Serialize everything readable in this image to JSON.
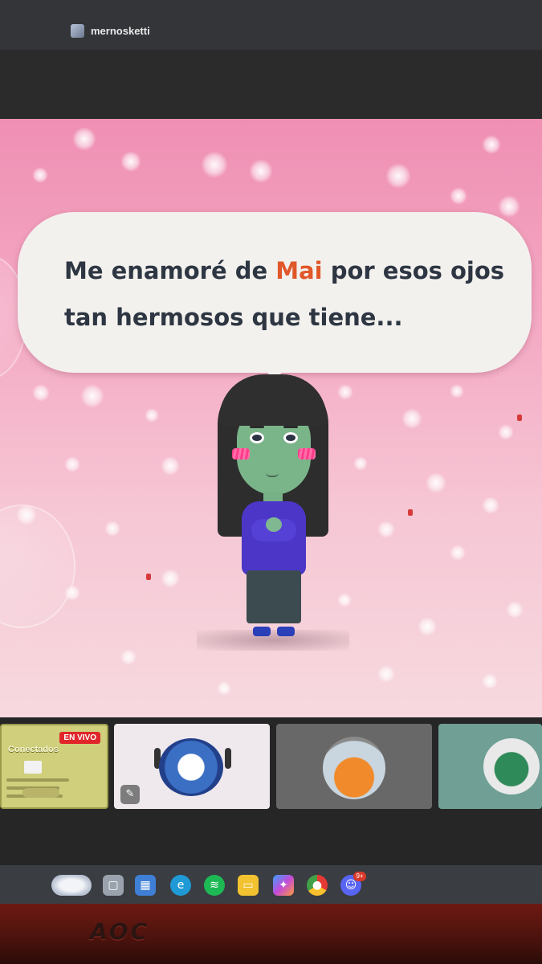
{
  "stream": {
    "username": "mernosketti"
  },
  "game": {
    "dialogue_before": "Me enamoré de ",
    "dialogue_name": "Mai",
    "dialogue_after": " por esos ojos tan hermosos que tiene...",
    "colors": {
      "background_top": "#ef8fb3",
      "background_bottom": "#f7d9df",
      "name_highlight": "#e0572a",
      "dialogue_text": "#2d3642",
      "mii_shirt": "#4b36c8",
      "mii_face": "#7ab58a",
      "blush": "#ff3d8a"
    }
  },
  "thumbnails": [
    {
      "title": "Conectados",
      "badge": "EN VIVO"
    },
    {
      "icon": "clip-icon"
    },
    {
      "icon": "avatar"
    },
    {
      "icon": "player-photo"
    }
  ],
  "taskbar": {
    "icons": [
      "weather-widget",
      "task-view-icon",
      "store-icon",
      "edge-icon",
      "spotify-icon",
      "file-explorer-icon",
      "copilot-icon",
      "chrome-icon",
      "discord-icon"
    ],
    "discord_badge": "9+"
  },
  "monitor": {
    "brand": "AOC"
  }
}
